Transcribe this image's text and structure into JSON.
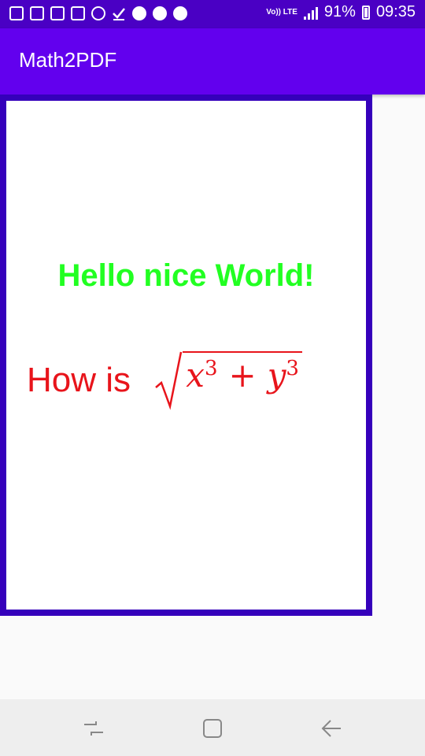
{
  "status_bar": {
    "notification_icons": [
      "message-icon",
      "calendar-icon",
      "image-icon",
      "gmail-icon",
      "whatsapp-icon",
      "check-download-icon",
      "chrome-icon",
      "chrome-icon",
      "chrome-icon"
    ],
    "network_label": "Vo)) LTE",
    "battery_percent": "91%",
    "time": "09:35"
  },
  "app_bar": {
    "title": "Math2PDF",
    "color": "#6200ee"
  },
  "pdf_preview": {
    "heading": "Hello nice World!",
    "heading_color": "#22ff22",
    "text_prefix": "How is ",
    "formula": {
      "var1": "x",
      "exp1": "3",
      "operator": "+",
      "var2": "y",
      "exp2": "3"
    },
    "text_color": "#e8141b",
    "frame_color": "#3500bb"
  },
  "nav_bar": {
    "buttons": [
      "recent-apps-icon",
      "home-icon",
      "back-icon"
    ]
  }
}
